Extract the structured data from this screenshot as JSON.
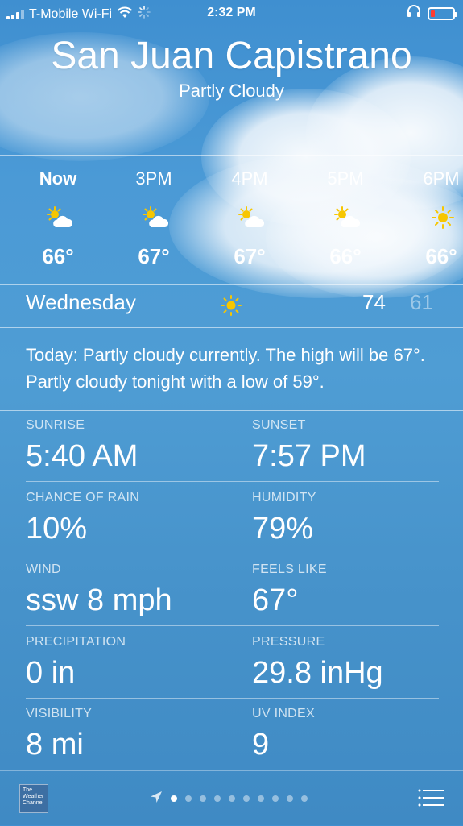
{
  "status_bar": {
    "carrier": "T-Mobile Wi-Fi",
    "time": "2:32 PM"
  },
  "location": {
    "city": "San Juan Capistrano",
    "condition": "Partly Cloudy"
  },
  "hourly": [
    {
      "label": "Now",
      "icon": "partly-cloudy-icon",
      "temp": "66°"
    },
    {
      "label": "3PM",
      "icon": "partly-cloudy-icon",
      "temp": "67°"
    },
    {
      "label": "4PM",
      "icon": "partly-cloudy-icon",
      "temp": "67°"
    },
    {
      "label": "5PM",
      "icon": "partly-cloudy-icon",
      "temp": "66°"
    },
    {
      "label": "6PM",
      "icon": "sunny-icon",
      "temp": "66°"
    }
  ],
  "daily": {
    "day": "Wednesday",
    "icon": "sunny-icon",
    "high": "74",
    "low": "61"
  },
  "summary": "Today: Partly cloudy currently. The high will be 67°. Partly cloudy tonight with a low of 59°.",
  "details": [
    {
      "left_label": "SUNRISE",
      "left_value": "5:40 AM",
      "right_label": "SUNSET",
      "right_value": "7:57 PM"
    },
    {
      "left_label": "CHANCE OF RAIN",
      "left_value": "10%",
      "right_label": "HUMIDITY",
      "right_value": "79%"
    },
    {
      "left_label": "WIND",
      "left_value": "ssw 8 mph",
      "right_label": "FEELS LIKE",
      "right_value": "67°"
    },
    {
      "left_label": "PRECIPITATION",
      "left_value": "0 in",
      "right_label": "PRESSURE",
      "right_value": "29.8 inHg"
    },
    {
      "left_label": "VISIBILITY",
      "left_value": "8 mi",
      "right_label": "UV INDEX",
      "right_value": "9"
    }
  ],
  "footer": {
    "logo_text": "The Weather Channel",
    "page_count": 10,
    "active_page": 1
  },
  "colors": {
    "sun": "#f7c600",
    "battery_low": "#ff3b30"
  }
}
